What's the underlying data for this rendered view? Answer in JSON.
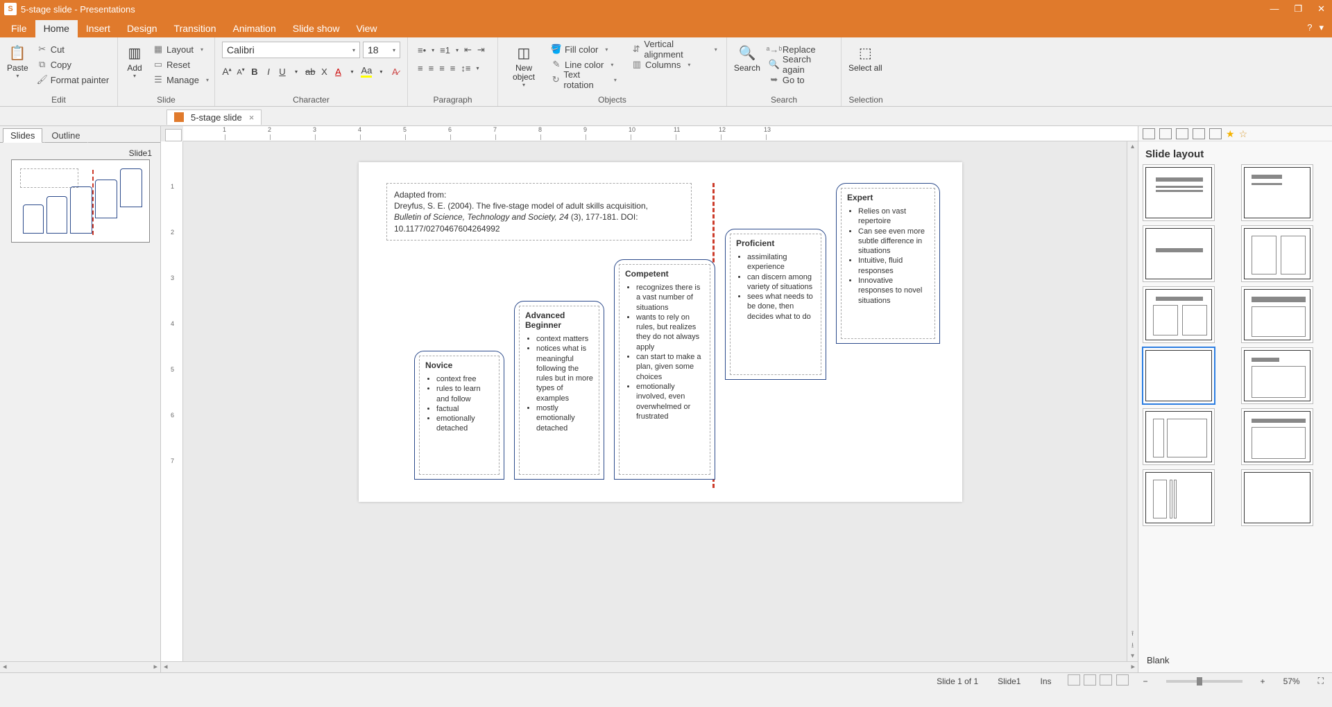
{
  "titlebar": {
    "app_icon_letter": "S",
    "title": "5-stage slide - Presentations"
  },
  "menu": {
    "tabs": [
      "File",
      "Home",
      "Insert",
      "Design",
      "Transition",
      "Animation",
      "Slide show",
      "View"
    ],
    "active_index": 1,
    "help_glyphs": [
      "?",
      "▾"
    ]
  },
  "ribbon": {
    "edit": {
      "label": "Edit",
      "paste": "Paste",
      "cut": "Cut",
      "copy": "Copy",
      "format_painter": "Format painter"
    },
    "slide": {
      "label": "Slide",
      "add": "Add",
      "layout": "Layout",
      "reset": "Reset",
      "manage": "Manage"
    },
    "character": {
      "label": "Character",
      "font": "Calibri",
      "size": "18"
    },
    "paragraph": {
      "label": "Paragraph"
    },
    "objects": {
      "label": "Objects",
      "new_object": "New object",
      "fill_color": "Fill color",
      "line_color": "Line color",
      "text_rotation": "Text rotation",
      "valign": "Vertical alignment",
      "columns": "Columns"
    },
    "search": {
      "label": "Search",
      "search": "Search",
      "replace": "Replace",
      "search_again": "Search again",
      "goto": "Go to"
    },
    "selection": {
      "label": "Selection",
      "select_all": "Select all"
    }
  },
  "doc_tab": {
    "name": "5-stage slide"
  },
  "slides_panel": {
    "tabs": [
      "Slides",
      "Outline"
    ],
    "active_index": 0,
    "thumb_label": "Slide1"
  },
  "slide_content": {
    "adapted": {
      "heading": "Adapted from:",
      "line_a": "Dreyfus, S. E. (2004).  The five-stage model of adult skills acquisition,",
      "line_b_pre": "Bulletin of Science, Technology and Society, 24",
      "line_b_post": " (3), 177-181. DOI: 10.1177/0270467604264992"
    },
    "stages": [
      {
        "title": "Novice",
        "bullets": [
          "context free",
          "rules to learn and follow",
          "factual",
          "emotionally detached"
        ]
      },
      {
        "title": "Advanced Beginner",
        "bullets": [
          "context matters",
          "notices what is meaningful following the rules but in more types of examples",
          "mostly emotionally detached"
        ]
      },
      {
        "title": "Competent",
        "bullets": [
          "recognizes there is a vast number of situations",
          "wants to rely on rules, but realizes they do not always apply",
          "can start to make a plan, given some choices",
          "emotionally involved, even overwhelmed or frustrated"
        ]
      },
      {
        "title": "Proficient",
        "bullets": [
          "assimilating experience",
          "can discern among variety of situations",
          "sees what needs to be done, then decides what to do"
        ]
      },
      {
        "title": "Expert",
        "bullets": [
          "Relies on vast repertoire",
          "Can see even more subtle difference in situations",
          "Intuitive, fluid responses",
          "Innovative responses to novel situations"
        ]
      }
    ]
  },
  "layout_panel": {
    "title": "Slide layout",
    "selected_label": "Blank",
    "selected_index": 6
  },
  "statusbar": {
    "slide_of": "Slide 1 of 1",
    "slide_name": "Slide1",
    "ins": "Ins",
    "zoom": "57%"
  },
  "h_ruler_ticks": [
    "1",
    "2",
    "3",
    "4",
    "5",
    "6",
    "7",
    "8",
    "9",
    "10",
    "11",
    "12",
    "13"
  ],
  "v_ruler_ticks": [
    "1",
    "2",
    "3",
    "4",
    "5",
    "6",
    "7"
  ]
}
